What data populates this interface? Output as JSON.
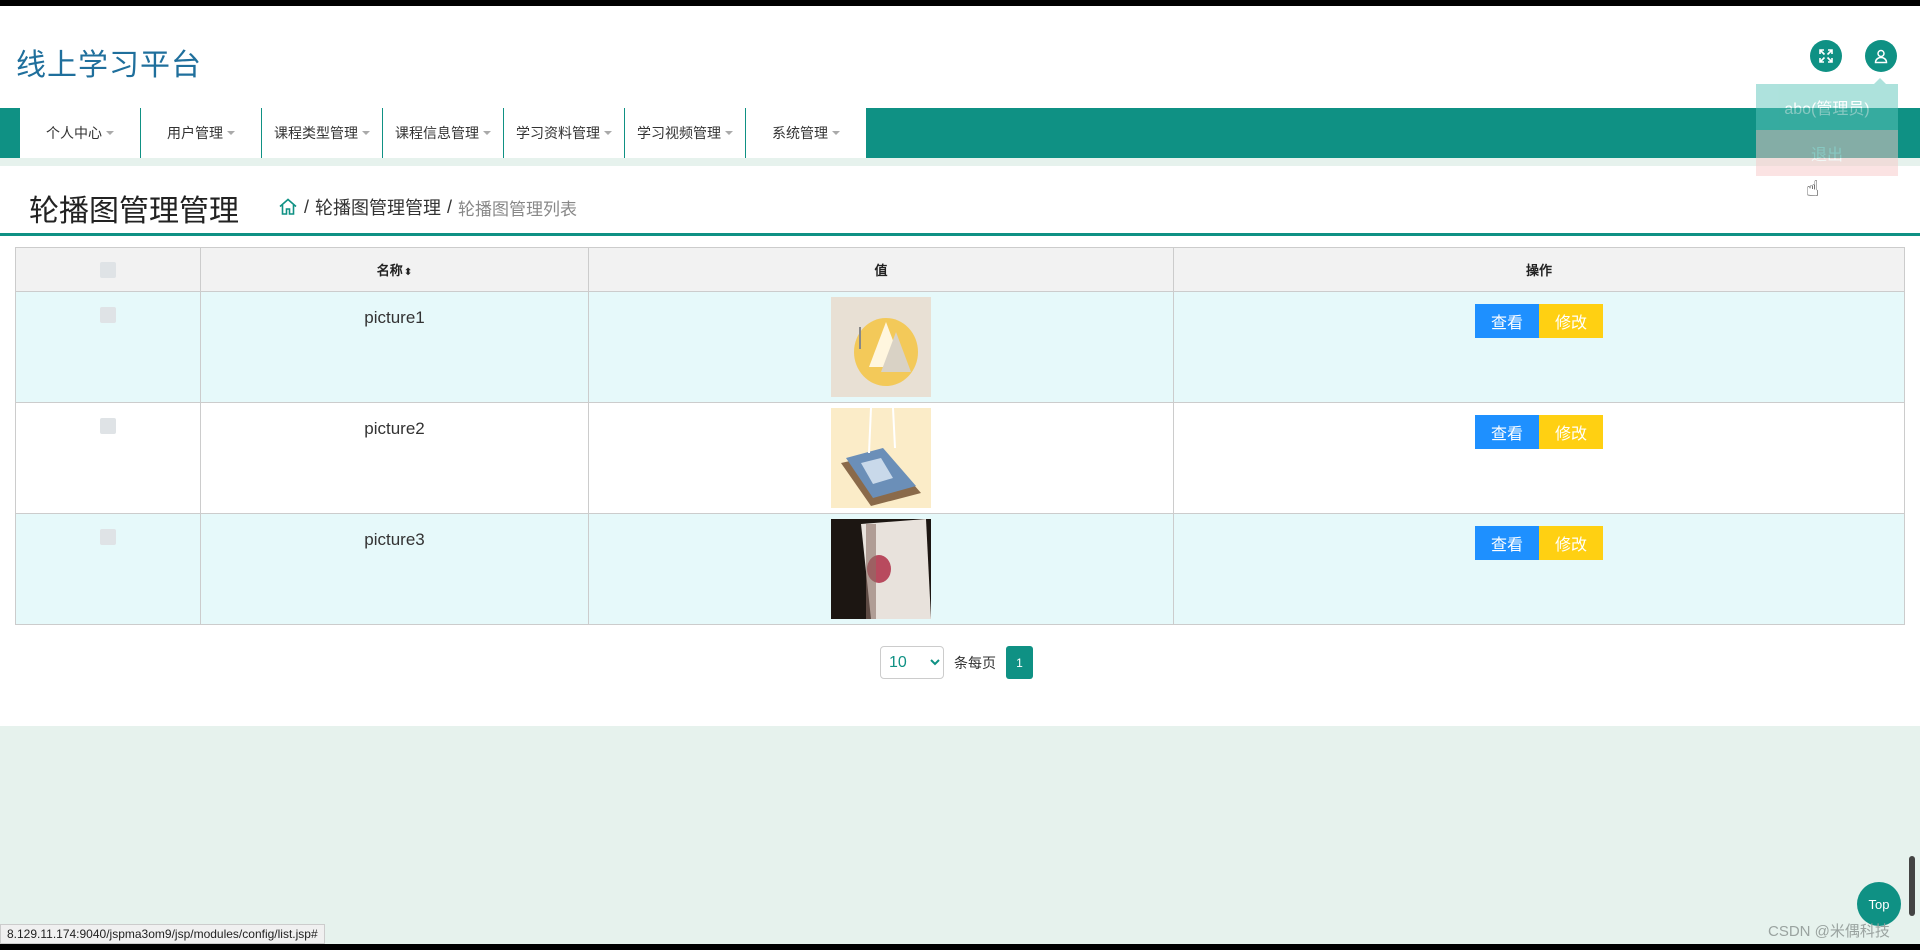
{
  "header": {
    "site_title": "线上学习平台"
  },
  "user_menu": {
    "username": "abo(管理员)",
    "logout": "退出"
  },
  "nav": {
    "items": [
      {
        "label": "个人中心"
      },
      {
        "label": "用户管理"
      },
      {
        "label": "课程类型管理"
      },
      {
        "label": "课程信息管理"
      },
      {
        "label": "学习资料管理"
      },
      {
        "label": "学习视频管理"
      },
      {
        "label": "系统管理"
      }
    ]
  },
  "page": {
    "title": "轮播图管理管理",
    "breadcrumb": {
      "level1": "轮播图管理管理",
      "current": "轮播图管理列表"
    }
  },
  "table": {
    "headers": {
      "name": "名称",
      "value": "值",
      "action": "操作"
    },
    "rows": [
      {
        "name": "picture1",
        "view": "查看",
        "edit": "修改"
      },
      {
        "name": "picture2",
        "view": "查看",
        "edit": "修改"
      },
      {
        "name": "picture3",
        "view": "查看",
        "edit": "修改"
      }
    ]
  },
  "pager": {
    "page_size": "10",
    "per_page_label": "条每页",
    "current_page": "1"
  },
  "top_button": "Top",
  "status_url": "8.129.11.174:9040/jspma3om9/jsp/modules/config/list.jsp#",
  "watermark": "CSDN @米偶科技",
  "colors": {
    "primary": "#0f9184",
    "view_button": "#1e90ff",
    "edit_button": "#ffd012",
    "title": "#1f6f9c"
  }
}
